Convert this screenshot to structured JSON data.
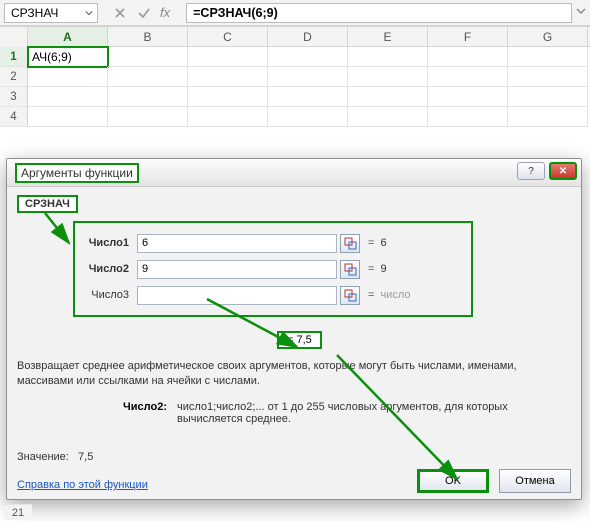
{
  "nameBox": "СРЗНАЧ",
  "formula": "=СРЗНАЧ(6;9)",
  "columns": [
    "A",
    "B",
    "C",
    "D",
    "E",
    "F",
    "G"
  ],
  "rows": [
    "1",
    "2",
    "3",
    "4"
  ],
  "activeCellValue": "АЧ(6;9)",
  "dialog": {
    "title": "Аргументы функции",
    "fnName": "СРЗНАЧ",
    "args": [
      {
        "label": "Число1",
        "value": "6",
        "result": "6",
        "bold": true
      },
      {
        "label": "Число2",
        "value": "9",
        "result": "9",
        "bold": true
      },
      {
        "label": "Число3",
        "value": "",
        "result": "число",
        "bold": false
      }
    ],
    "resultPrefix": "=  ",
    "resultValue": "7,5",
    "description": "Возвращает среднее арифметическое своих аргументов, которые могут быть числами, именами, массивами или ссылками на ячейки с числами.",
    "argHelpLabel": "Число2:",
    "argHelpText": "число1;число2;... от 1 до 255 числовых аргументов, для которых вычисляется среднее.",
    "valueLabel": "Значение:",
    "valueResult": "7,5",
    "helpLink": "Справка по этой функции",
    "okLabel": "OK",
    "cancelLabel": "Отмена",
    "helpBtn": "?",
    "closeBtn": "✕"
  },
  "bottomRow": "21",
  "fxLabel": "fx"
}
